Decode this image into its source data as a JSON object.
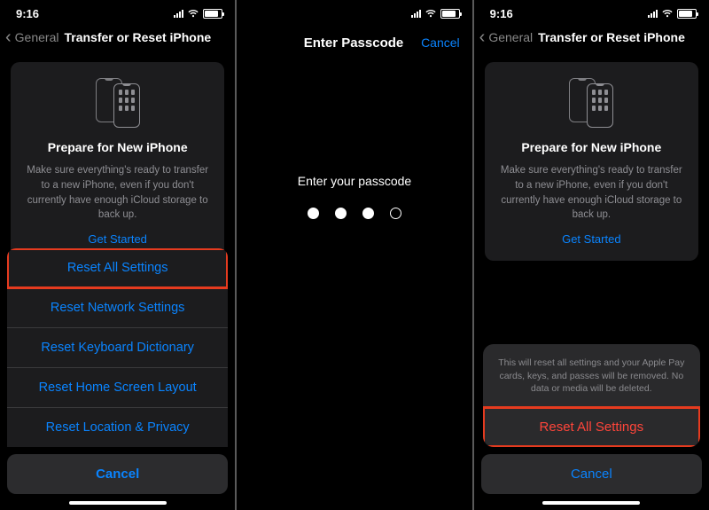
{
  "status": {
    "time": "9:16"
  },
  "nav": {
    "back_label": "General",
    "title": "Transfer or Reset iPhone"
  },
  "prepare": {
    "heading": "Prepare for New iPhone",
    "body": "Make sure everything's ready to transfer to a new iPhone, even if you don't currently have enough iCloud storage to back up.",
    "cta": "Get Started"
  },
  "options": {
    "reset_all": "Reset All Settings",
    "reset_network": "Reset Network Settings",
    "reset_keyboard": "Reset Keyboard Dictionary",
    "reset_home": "Reset Home Screen Layout",
    "reset_location": "Reset Location & Privacy",
    "cancel": "Cancel"
  },
  "passcode": {
    "title": "Enter Passcode",
    "action": "Cancel",
    "prompt": "Enter your passcode",
    "filled": 3,
    "total": 4
  },
  "confirm": {
    "message": "This will reset all settings and your Apple Pay cards, keys, and passes will be removed. No data or media will be deleted.",
    "destructive": "Reset All Settings",
    "cancel": "Cancel"
  }
}
